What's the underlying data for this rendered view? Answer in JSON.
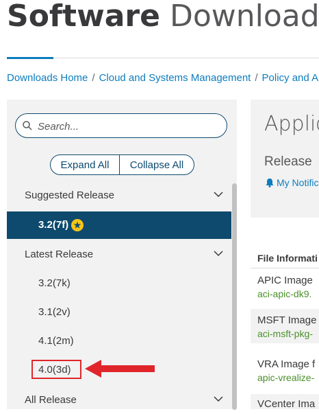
{
  "header": {
    "title_strong": "Software",
    "title_light": "Download"
  },
  "breadcrumb": [
    "Downloads Home",
    "Cloud and Systems Management",
    "Policy and Au"
  ],
  "sidebar": {
    "search_placeholder": "Search...",
    "expand_all_label": "Expand All",
    "collapse_all_label": "Collapse All",
    "suggested": {
      "label": "Suggested Release",
      "items": [
        {
          "label": "3.2(7f)",
          "selected": true,
          "badge": "star-icon"
        }
      ]
    },
    "latest": {
      "label": "Latest Release",
      "items": [
        {
          "label": "3.2(7k)"
        },
        {
          "label": "3.1(2v)"
        },
        {
          "label": "4.1(2m)"
        },
        {
          "label": "4.0(3d)",
          "highlighted": true
        }
      ]
    },
    "all": {
      "label": "All Release"
    }
  },
  "main": {
    "title": "Applic",
    "release_label": "Release",
    "notifications_label": "My Notific",
    "file_info_header": "File Informati",
    "files": [
      {
        "name": "APIC Image",
        "file": "aci-apic-dk9."
      },
      {
        "name": "MSFT Image",
        "file": "aci-msft-pkg-"
      },
      {
        "name": "VRA Image f",
        "file": "apic-vrealize-"
      },
      {
        "name": "VCenter Ima",
        "file": ""
      }
    ]
  },
  "colors": {
    "accent": "#0d7dbd",
    "selected_bg": "#0d4a6e",
    "highlight": "#e0262b",
    "star": "#f5c518",
    "file_link": "#4b8f2a"
  }
}
